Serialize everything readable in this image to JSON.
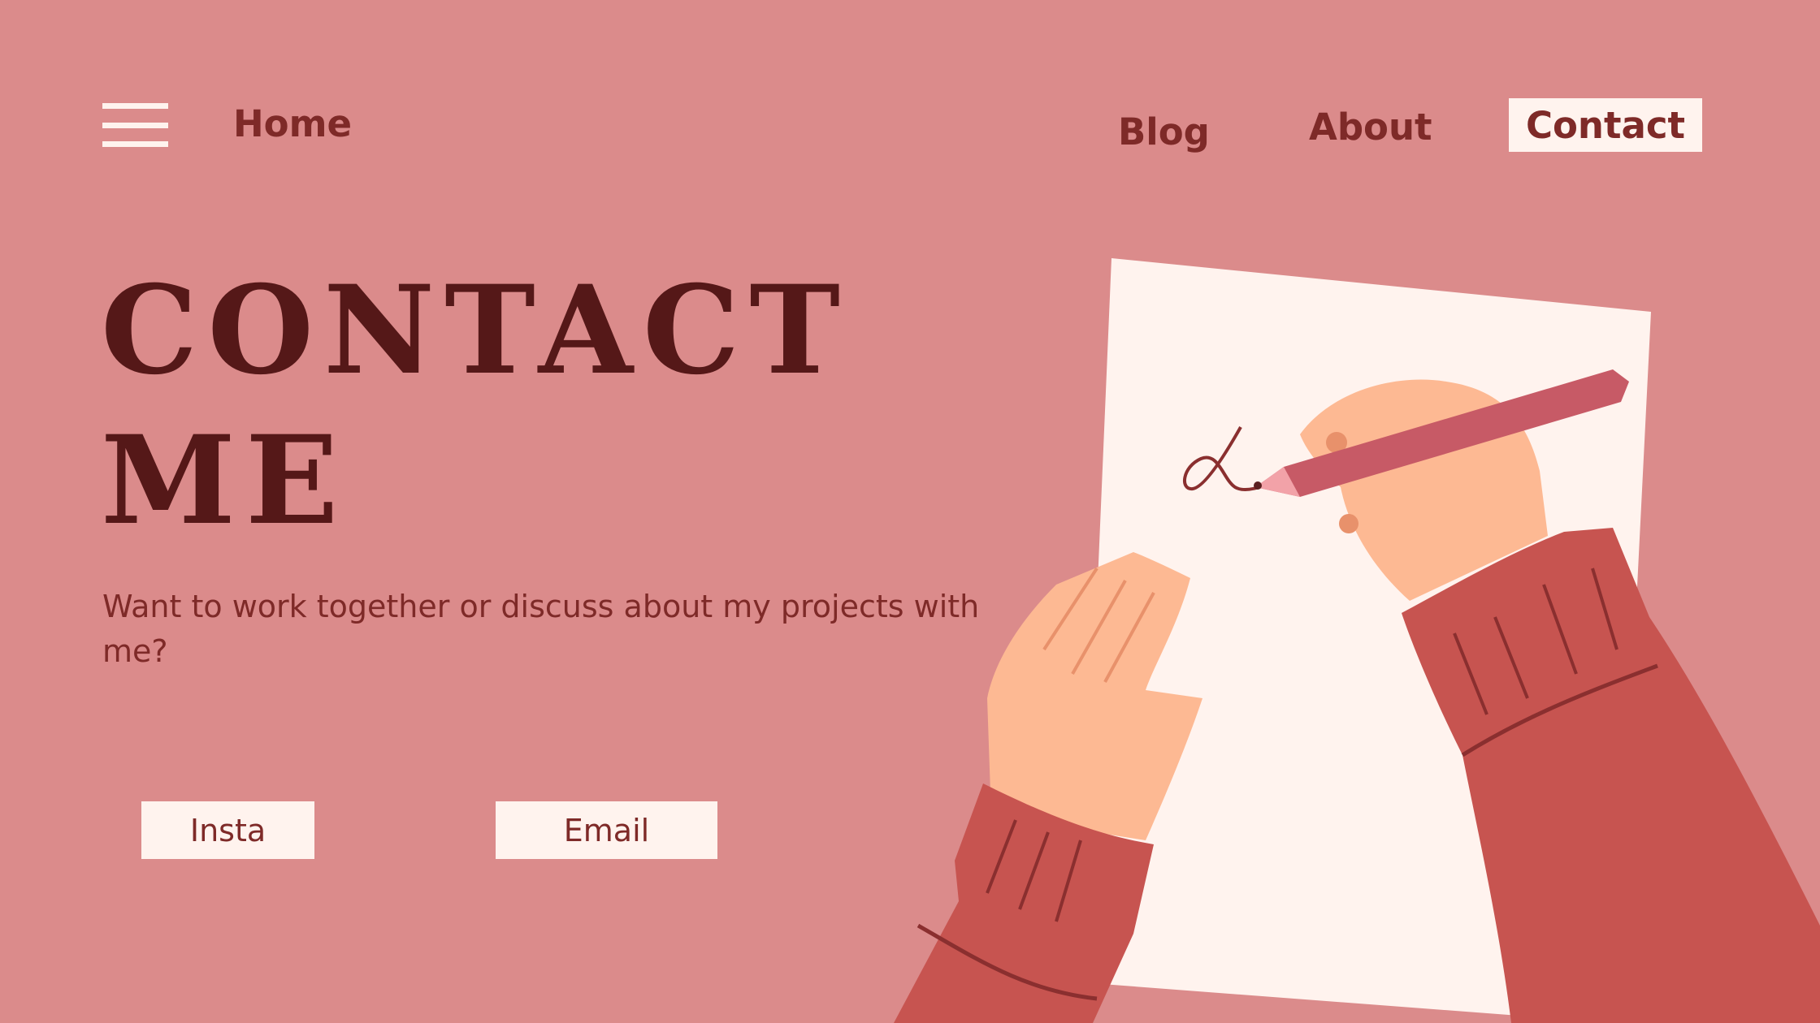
{
  "nav": {
    "menu_icon": "hamburger-menu-icon",
    "home": "Home",
    "blog": "Blog",
    "about": "About",
    "contact": "Contact"
  },
  "hero": {
    "title_line1": "CONTACT",
    "title_line2": "ME",
    "subtitle": "Want to work together or discuss about my projects with me?"
  },
  "buttons": {
    "insta": "Insta",
    "email": "Email"
  },
  "illustration": {
    "name": "hands-writing-on-paper-illustration"
  },
  "colors": {
    "background": "#db8b8b",
    "accent_dark": "#551818",
    "text": "#7e2a28",
    "light": "#fff3ee",
    "sleeve": "#c75450",
    "skin": "#fdb993"
  }
}
